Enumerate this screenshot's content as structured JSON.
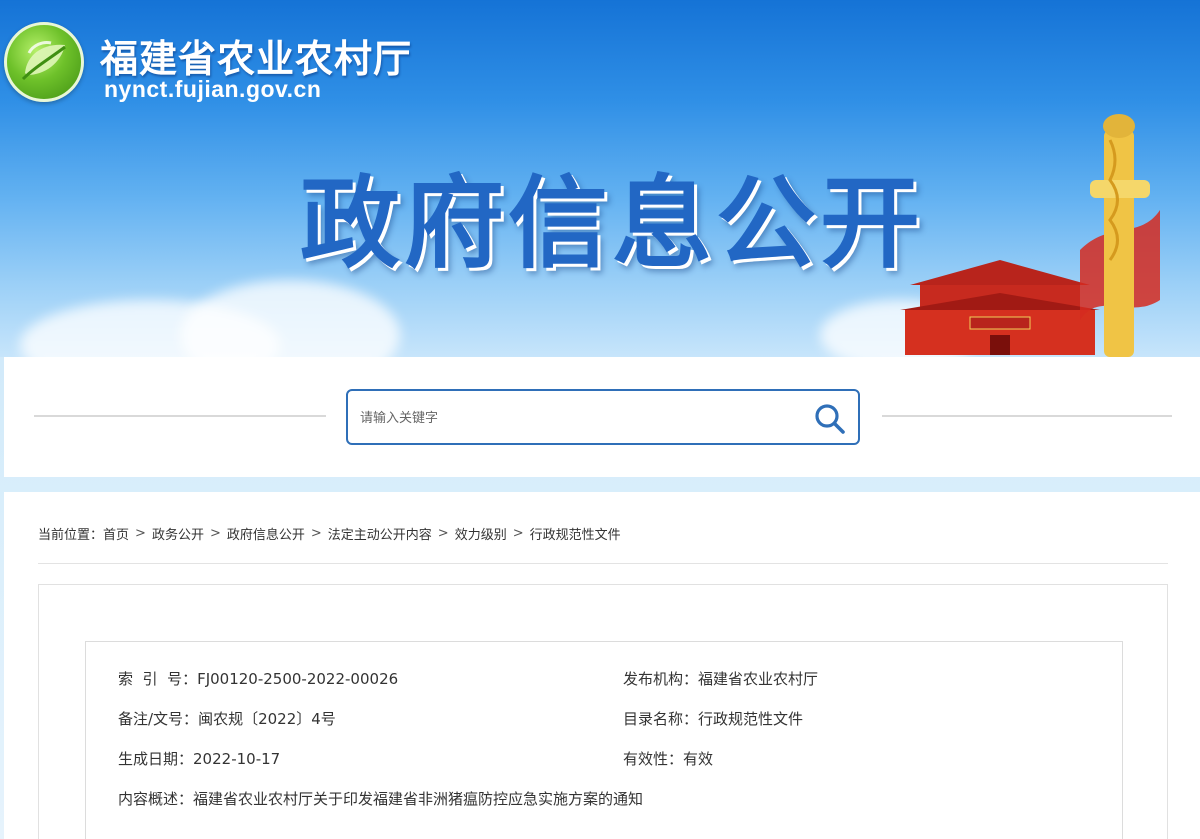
{
  "header": {
    "site_title": "福建省农业农村厅",
    "site_domain": "nynct.fujian.gov.cn",
    "section_heading": "政府信息公开"
  },
  "search": {
    "placeholder": "请输入关键字"
  },
  "breadcrumb": {
    "prefix": "当前位置：",
    "items": [
      "首页",
      "政务公开",
      "政府信息公开",
      "法定主动公开内容",
      "效力级别",
      "行政规范性文件"
    ],
    "separator": ">"
  },
  "meta": {
    "index_no_label": "索  引  号：",
    "index_no": "FJ00120-2500-2022-00026",
    "publisher_label": "发布机构：",
    "publisher": "福建省农业农村厅",
    "doc_no_label": "备注/文号：",
    "doc_no": "闽农规〔2022〕4号",
    "catalog_label": "目录名称：",
    "catalog": "行政规范性文件",
    "date_label": "生成日期：",
    "date": "2022-10-17",
    "validity_label": "有效性：",
    "validity": "有效",
    "summary_label": "内容概述：",
    "summary": "福建省农业农村厅关于印发福建省非洲猪瘟防控应急实施方案的通知"
  },
  "colors": {
    "banner_blue": "#1573d6",
    "heading_blue": "#2267c4",
    "search_border": "#2f6fb8",
    "logo_green": "#6ec12a"
  }
}
